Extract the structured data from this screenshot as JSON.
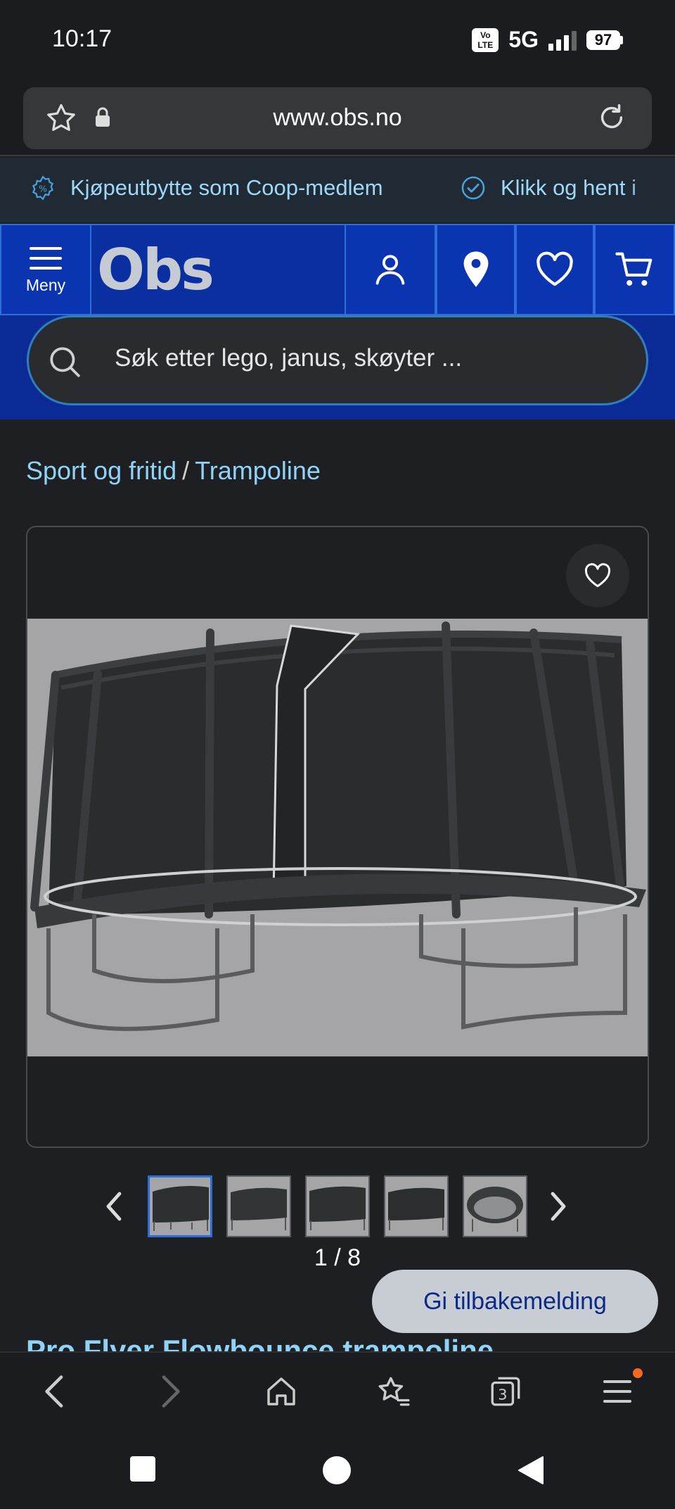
{
  "status_bar": {
    "time": "10:17",
    "volte": "Vo LTE",
    "network": "5G",
    "battery": "97"
  },
  "browser": {
    "url": "www.obs.no"
  },
  "promo": {
    "item1": "Kjøpeutbytte som Coop-medlem",
    "item2": "Klikk og hent i"
  },
  "header": {
    "menu_label": "Meny",
    "logo": "Obs"
  },
  "search": {
    "placeholder": "Søk etter lego, janus, skøyter ..."
  },
  "breadcrumb": {
    "category": "Sport og fritid",
    "separator": "/",
    "subcategory": "Trampoline"
  },
  "gallery": {
    "counter": "1 / 8",
    "thumbnail_count": 5,
    "active_index": 0
  },
  "feedback": {
    "label": "Gi tilbakemelding"
  },
  "product": {
    "title": "Pro Flyer Flowbounce trampoline"
  },
  "bottom_nav": {
    "tabs_count": "3"
  },
  "colors": {
    "brand_blue": "#0a34b0",
    "link": "#8fd3f7",
    "accent": "#f26a21"
  }
}
